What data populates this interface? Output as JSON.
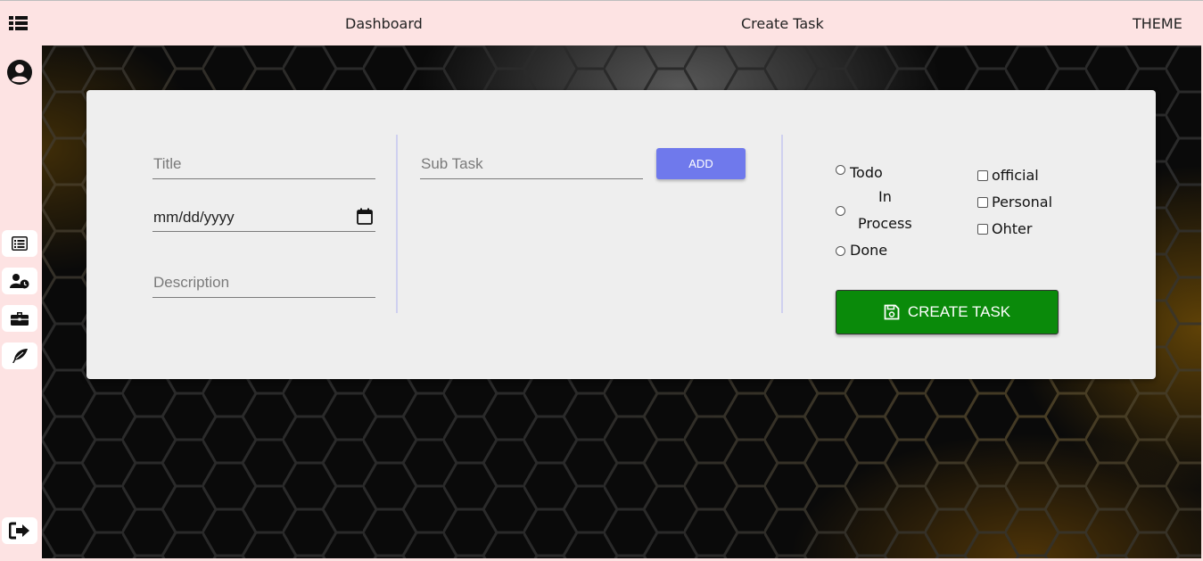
{
  "nav": {
    "dashboard": "Dashboard",
    "create_task": "Create Task",
    "theme": "THEME"
  },
  "sidebar": {
    "icons": [
      "menu-icon",
      "user-circle-icon",
      "list-icon",
      "user-clock-icon",
      "briefcase-icon",
      "feather-icon",
      "sign-out-icon"
    ]
  },
  "form": {
    "title_placeholder": "Title",
    "date_placeholder": "mm/dd/yyyy",
    "description_placeholder": "Description",
    "subtask_placeholder": "Sub Task",
    "add_label": "ADD",
    "status_options": [
      "Todo",
      "In",
      "Process",
      "Done"
    ],
    "category_options": [
      "official",
      "Personal",
      "Ohter"
    ],
    "create_label": "CREATE TASK"
  },
  "colors": {
    "header_bg": "#fde3e3",
    "add_button": "#6f79ec",
    "create_button": "#0a8a0a"
  }
}
